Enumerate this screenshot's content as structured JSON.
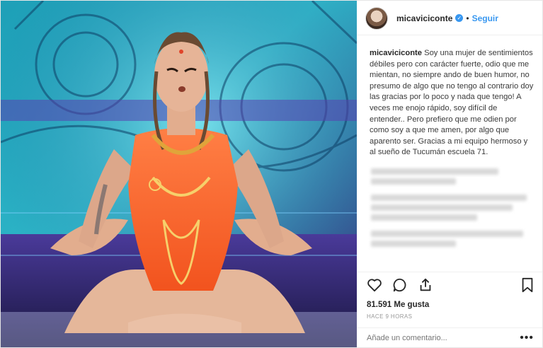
{
  "header": {
    "username": "micaviciconte",
    "verified_mark": "✓",
    "separator": "•",
    "follow_label": "Seguir"
  },
  "caption": {
    "username": "micaviciconte",
    "text": "Soy una mujer de sentimientos débiles pero con carácter fuerte, odio que me mientan, no siempre ando de buen humor, no presumo de algo que no tengo al contrario doy las gracias por lo poco y nada que tengo! A veces me enojo rápido, soy difícil de entender.. Pero prefiero que me odien por como soy a que me amen, por algo que aparento ser. Gracias a mi equipo hermoso y al sueño de Tucumán escuela 71."
  },
  "actions": {
    "icons": [
      "heart-icon",
      "comment-icon",
      "share-icon",
      "bookmark-icon"
    ],
    "likes": "81.591 Me gusta",
    "time": "HACE 9 HORAS"
  },
  "comment_box": {
    "placeholder": "Añade un comentario...",
    "more_label": "•••"
  },
  "colors": {
    "accent": "#3897f0",
    "text": "#262626",
    "muted": "#999999",
    "border": "#efefef"
  }
}
